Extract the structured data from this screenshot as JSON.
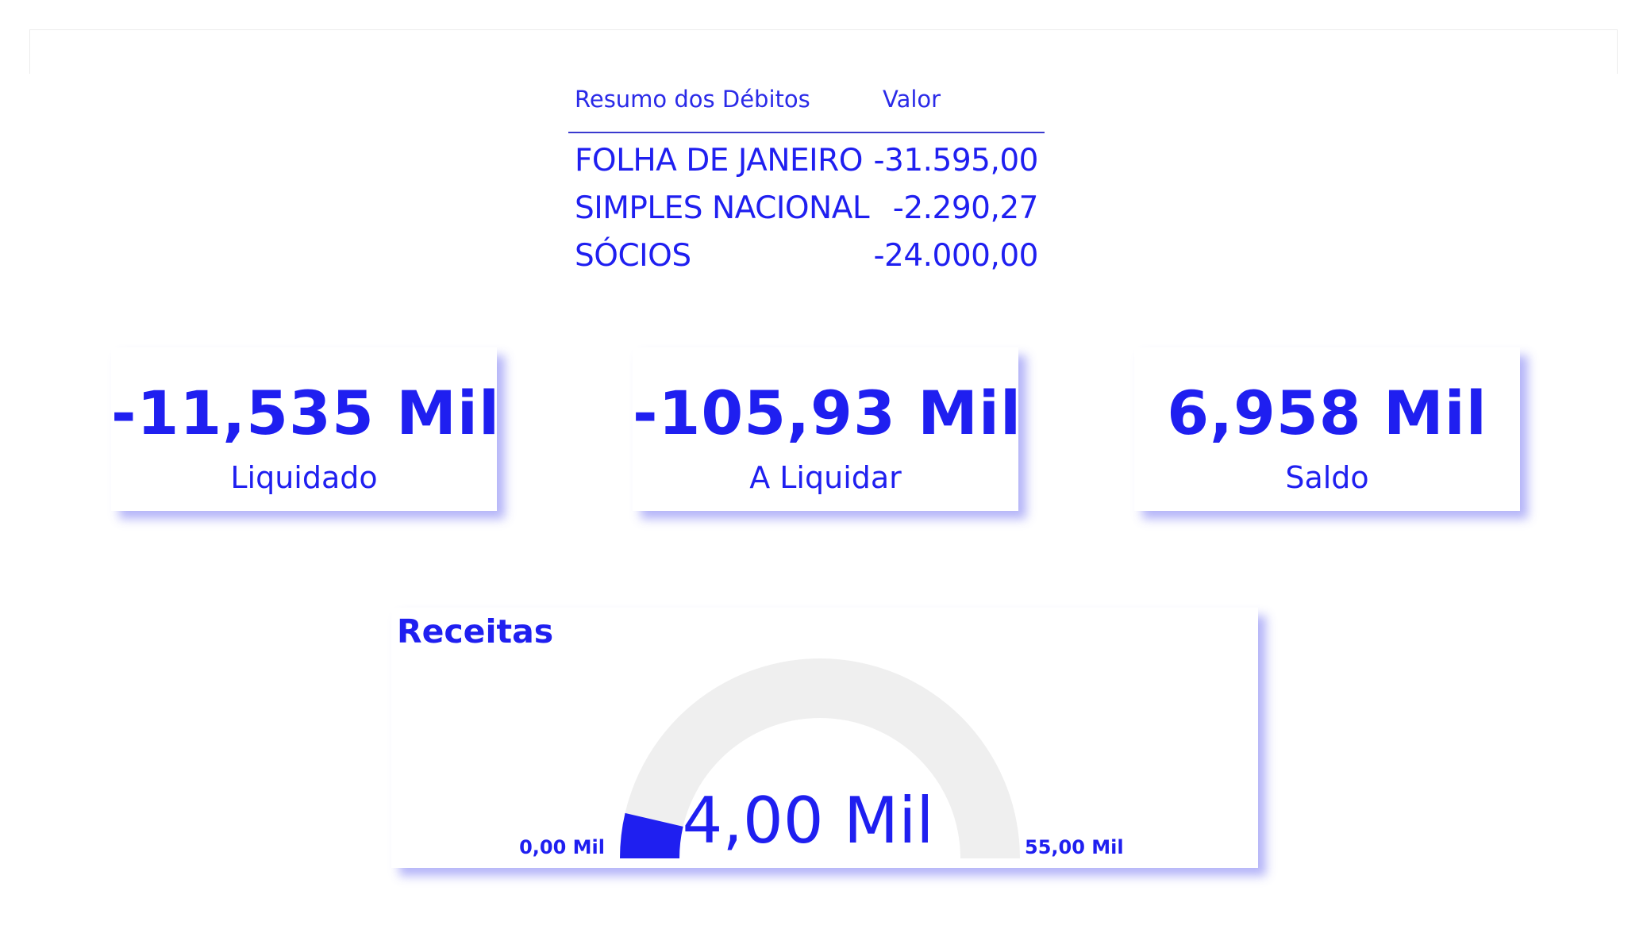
{
  "debits_table": {
    "headers": {
      "description": "Resumo dos Débitos",
      "value": "Valor"
    },
    "rows": [
      {
        "description": "FOLHA DE JANEIRO",
        "value": "-31.595,00"
      },
      {
        "description": "SIMPLES NACIONAL",
        "value": "-2.290,27"
      },
      {
        "description": "SÓCIOS",
        "value": "-24.000,00"
      }
    ]
  },
  "kpis": {
    "liquidado": {
      "value": "-11,535 Mil",
      "label": "Liquidado"
    },
    "a_liquidar": {
      "value": "-105,93 Mil",
      "label": "A Liquidar"
    },
    "saldo": {
      "value": "6,958 Mil",
      "label": "Saldo"
    }
  },
  "gauge": {
    "title": "Receitas",
    "value_label": "4,00 Mil",
    "min_label": "0,00 Mil",
    "max_label": "55,00 Mil",
    "value": 4.0,
    "min": 0.0,
    "max": 55.0
  },
  "colors": {
    "accent": "#1f1ff0",
    "gauge_track": "#efefef",
    "gauge_fill": "#1f1ff0"
  }
}
